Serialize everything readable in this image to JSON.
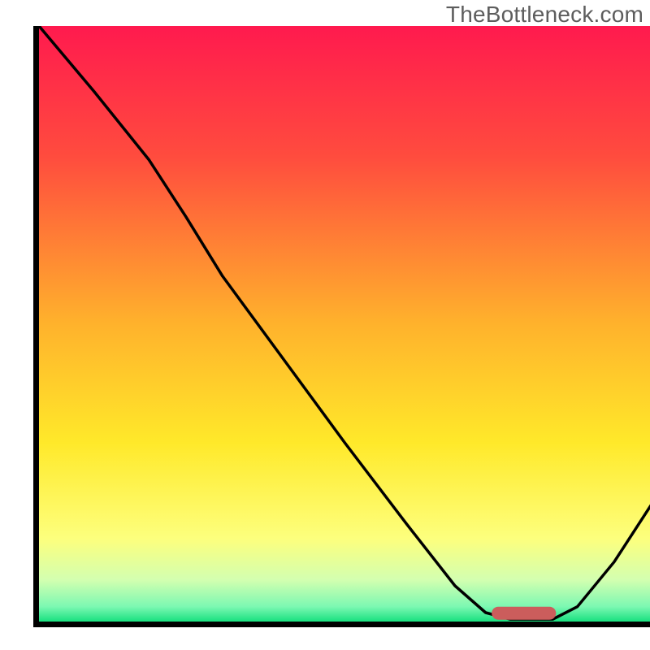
{
  "watermark": "TheBottleneck.com",
  "chart_data": {
    "type": "line",
    "title": "",
    "subtitle": "",
    "xlabel": "",
    "ylabel": "",
    "xrange": [
      0,
      100
    ],
    "yrange": [
      0,
      100
    ],
    "grid": false,
    "legend": false,
    "annotations": [],
    "background_gradient_stops": [
      {
        "pos": 0.0,
        "color": "#ff1a4e"
      },
      {
        "pos": 0.22,
        "color": "#ff4c3e"
      },
      {
        "pos": 0.5,
        "color": "#ffb22c"
      },
      {
        "pos": 0.7,
        "color": "#ffe92a"
      },
      {
        "pos": 0.86,
        "color": "#fdff7d"
      },
      {
        "pos": 0.93,
        "color": "#d3ffb0"
      },
      {
        "pos": 0.975,
        "color": "#7cf8b2"
      },
      {
        "pos": 1.0,
        "color": "#18e07f"
      }
    ],
    "curve_points": [
      {
        "x": 0.0,
        "y": 100.0
      },
      {
        "x": 9.0,
        "y": 89.0
      },
      {
        "x": 18.0,
        "y": 77.5
      },
      {
        "x": 24.0,
        "y": 68.0
      },
      {
        "x": 30.0,
        "y": 58.0
      },
      {
        "x": 40.0,
        "y": 44.0
      },
      {
        "x": 50.0,
        "y": 30.0
      },
      {
        "x": 60.0,
        "y": 16.5
      },
      {
        "x": 68.0,
        "y": 6.0
      },
      {
        "x": 73.0,
        "y": 1.5
      },
      {
        "x": 77.0,
        "y": 0.4
      },
      {
        "x": 84.0,
        "y": 0.4
      },
      {
        "x": 88.0,
        "y": 2.5
      },
      {
        "x": 94.0,
        "y": 10.0
      },
      {
        "x": 100.0,
        "y": 19.5
      }
    ],
    "marker": {
      "x_start": 74.0,
      "x_end": 84.5,
      "y": 1.4,
      "color": "#cb5d5c"
    }
  }
}
